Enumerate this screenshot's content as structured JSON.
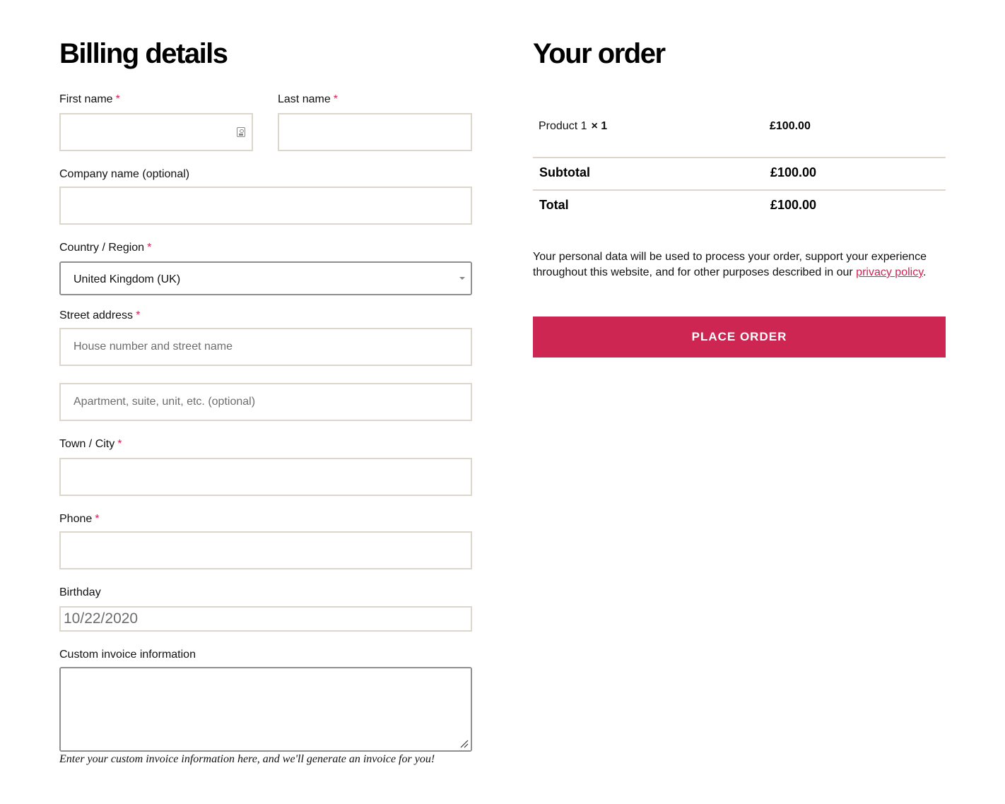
{
  "billing": {
    "title": "Billing details",
    "required_mark": "*",
    "first_name": {
      "label": "First name",
      "value": ""
    },
    "last_name": {
      "label": "Last name",
      "value": ""
    },
    "company": {
      "label": "Company name (optional)",
      "value": ""
    },
    "country": {
      "label": "Country / Region",
      "value": "United Kingdom (UK)"
    },
    "street": {
      "label": "Street address",
      "placeholder1": "House number and street name",
      "placeholder2": "Apartment, suite, unit, etc. (optional)"
    },
    "city": {
      "label": "Town / City",
      "value": ""
    },
    "phone": {
      "label": "Phone",
      "value": ""
    },
    "birthday": {
      "label": "Birthday",
      "value": "10/22/2020"
    },
    "invoice": {
      "label": "Custom invoice information",
      "help": "Enter your custom invoice information here, and we'll generate an invoice for you!"
    }
  },
  "order": {
    "title": "Your order",
    "product": {
      "name": "Product 1",
      "qty": "× 1",
      "price": "£100.00"
    },
    "subtotal": {
      "label": "Subtotal",
      "value": "£100.00"
    },
    "total": {
      "label": "Total",
      "value": "£100.00"
    },
    "privacy_text": "Your personal data will be used to process your order, support your experience throughout this website, and for other purposes described in our ",
    "privacy_link": "privacy policy",
    "privacy_end": ".",
    "place_order": "PLACE ORDER"
  },
  "colors": {
    "accent": "#cd2653",
    "border": "#dcd7ca"
  }
}
